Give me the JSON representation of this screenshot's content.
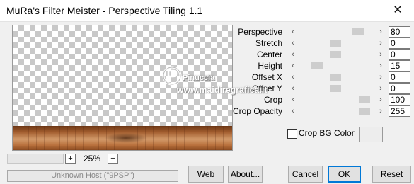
{
  "window": {
    "title": "MuRa's Filter Meister - Perspective Tiling 1.1",
    "close_glyph": "✕"
  },
  "params": [
    {
      "label": "Perspective",
      "value": "80",
      "slider_fraction": 0.82
    },
    {
      "label": "Stretch",
      "value": "0",
      "slider_fraction": 0.48
    },
    {
      "label": "Center",
      "value": "0",
      "slider_fraction": 0.48
    },
    {
      "label": "Height",
      "value": "15",
      "slider_fraction": 0.2
    },
    {
      "label": "Offset X",
      "value": "0",
      "slider_fraction": 0.48
    },
    {
      "label": "Offset Y",
      "value": "0",
      "slider_fraction": 0.48
    },
    {
      "label": "Crop",
      "value": "100",
      "slider_fraction": 0.92
    },
    {
      "label": "Crop Opacity",
      "value": "255",
      "slider_fraction": 0.92
    }
  ],
  "crop_bg": {
    "label": "Crop BG Color",
    "checked": false,
    "color": "#ededed"
  },
  "zoom": {
    "plus": "+",
    "value": "25%",
    "minus": "−"
  },
  "host": "Unknown Host (\"9PSP\")",
  "buttons": {
    "web": "Web",
    "about": "About...",
    "cancel": "Cancel",
    "ok": "OK",
    "reset": "Reset"
  },
  "watermark": {
    "line1": "Pinuccia",
    "line2": "www.maidiregrafica.it"
  },
  "colors": {
    "accent": "#0078d7",
    "floor": "#a25d2e"
  },
  "icons": {
    "slider_left": "‹",
    "slider_right": "›"
  }
}
